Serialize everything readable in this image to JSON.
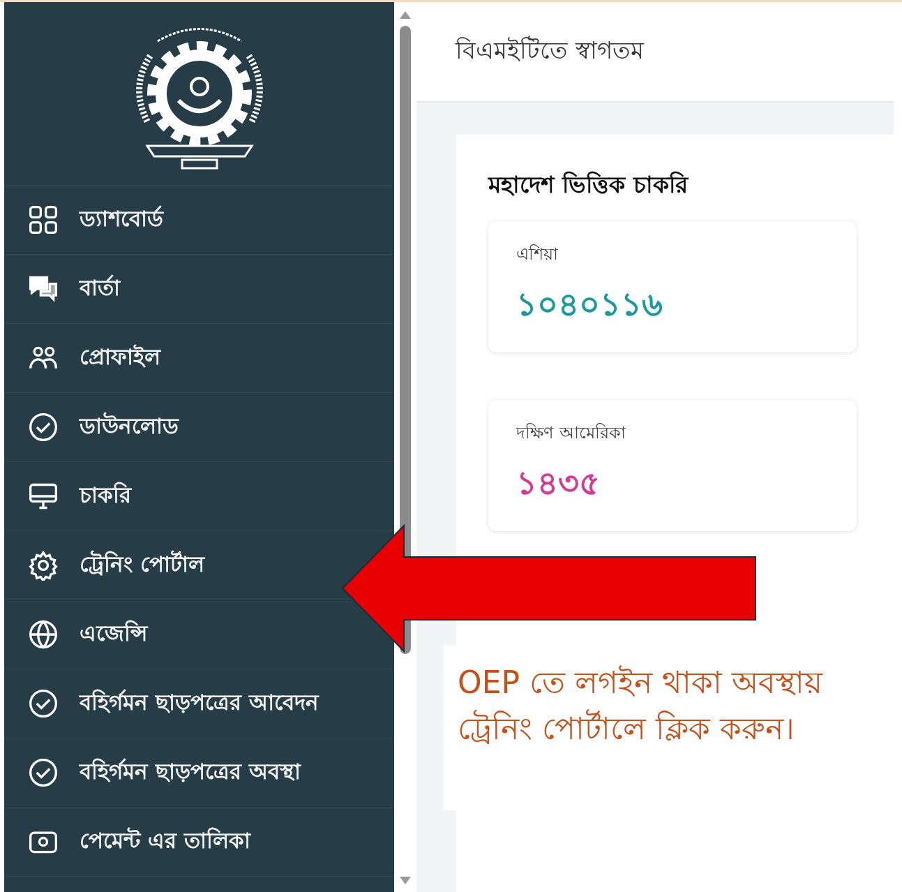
{
  "sidebar": {
    "items": [
      {
        "label": "ড্যাশবোর্ড",
        "kind": "grid"
      },
      {
        "label": "বার্তা",
        "kind": "chat"
      },
      {
        "label": "প্রোফাইল",
        "kind": "users"
      },
      {
        "label": "ডাউনলোড",
        "kind": "check"
      },
      {
        "label": "চাকরি",
        "kind": "monitor"
      },
      {
        "label": "ট্রেনিং পোর্টাল",
        "kind": "gear"
      },
      {
        "label": "এজেন্সি",
        "kind": "globe"
      },
      {
        "label": "বহির্গমন ছাড়পত্রের আবেদন",
        "kind": "check"
      },
      {
        "label": "বহির্গমন ছাড়পত্রের অবস্থা",
        "kind": "check"
      },
      {
        "label": "পেমেন্ট এর তালিকা",
        "kind": "wallet"
      }
    ]
  },
  "header": {
    "title": "বিএমইটিতে স্বাগতম"
  },
  "jobs_card": {
    "title": "মহাদেশ ভিত্তিক চাকরি",
    "stats": [
      {
        "region": "এশিয়া",
        "count": "১০৪০১১৬",
        "color": "#1a9a9e"
      },
      {
        "region": "দক্ষিণ আমেরিকা",
        "count": "১৪৩৫",
        "color": "#d23a96"
      }
    ]
  },
  "annotation": {
    "text": "OEP তে লগইন থাকা অবস্থায় ট্রেনিং পোর্টালে ক্লিক করুন।"
  }
}
